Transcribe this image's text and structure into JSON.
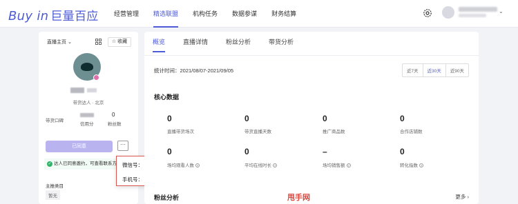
{
  "brand": {
    "logo_latin": "Buy in",
    "logo_cn": "巨量百应"
  },
  "nav": [
    "经营管理",
    "精选联盟",
    "机构任务",
    "数据参谋",
    "财务结算"
  ],
  "creator": {
    "homepage_label": "直播主页",
    "fav_label": "☆ 收藏",
    "subtitle": "带货达人 · 北京",
    "stats": [
      {
        "label": "带货口碑",
        "value": ""
      },
      {
        "label": "信用分",
        "value": ""
      },
      {
        "label": "粉丝数",
        "value": "0"
      }
    ],
    "agreed_button": "已同意",
    "more_button": "···",
    "notice": "达人已同意邀约，可查看联系方式",
    "category_label": "主推类目",
    "category_value": "暂无"
  },
  "popup": {
    "wechat_label": "微信号：",
    "phone_label": "手机号："
  },
  "tabs": [
    "概览",
    "直播详情",
    "粉丝分析",
    "带货分析"
  ],
  "period": "统计时间：2021/08/07-2021/09/05",
  "ranges": [
    "近7天",
    "近30天",
    "近90天"
  ],
  "core_title": "核心数据",
  "metrics": [
    {
      "value": "0",
      "label": "直播带货场次"
    },
    {
      "value": "0",
      "label": "带货直播天数"
    },
    {
      "value": "0",
      "label": "推广商品数"
    },
    {
      "value": "0",
      "label": "合作店铺数"
    },
    {
      "value": "0",
      "label": "场均观看人数"
    },
    {
      "value": "0",
      "label": "平均在线时长"
    },
    {
      "value": "–",
      "label": "场均销售额"
    },
    {
      "value": "0",
      "label": "转化指数"
    }
  ],
  "fans_title": "粉丝分析",
  "more": "更多 ›",
  "watermark": "甩手网",
  "colors": {
    "accent": "#4d5bd6",
    "agreed_btn": "#b9b4ef",
    "highlight_border": "#d9534f",
    "success": "#2fb56a"
  }
}
